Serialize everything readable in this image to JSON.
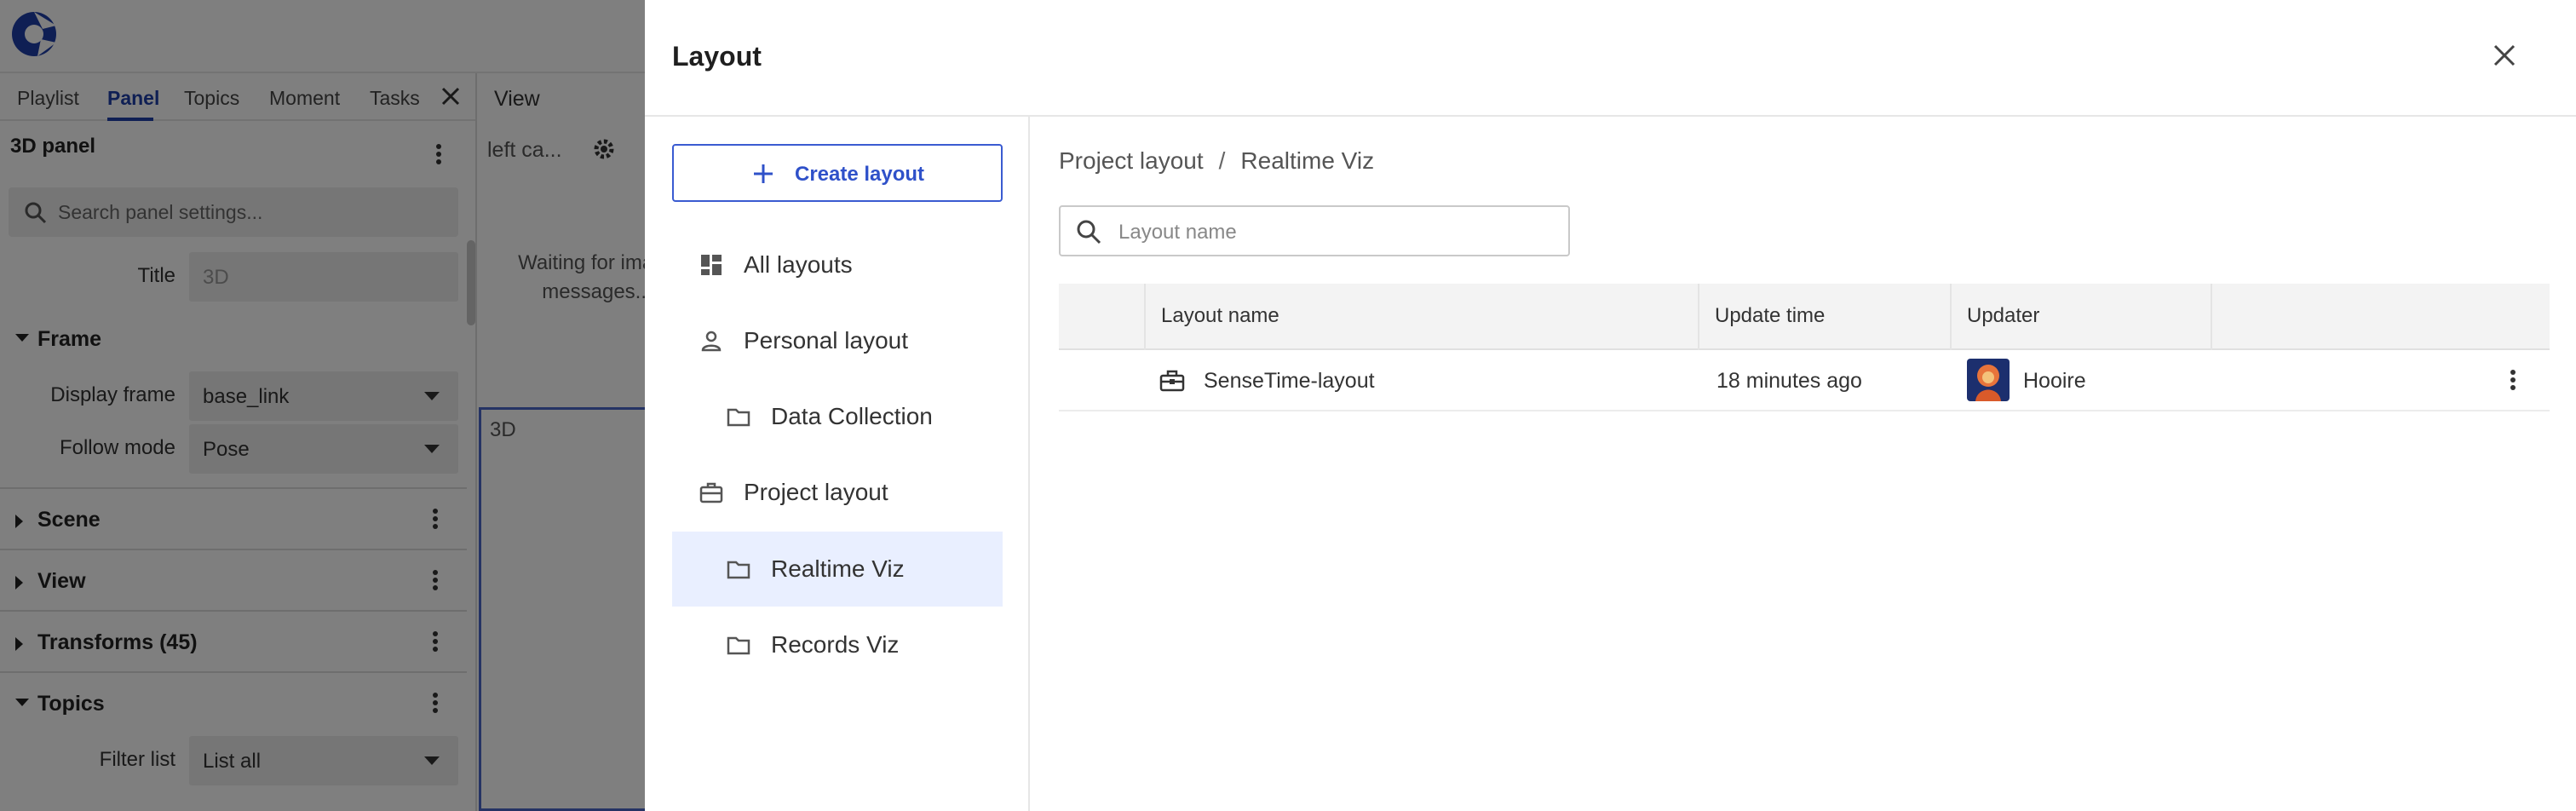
{
  "app": {
    "tabs": [
      "Playlist",
      "Panel",
      "Topics",
      "Moment",
      "Tasks"
    ],
    "panel_title": "3D panel",
    "search_placeholder": "Search panel settings...",
    "title_field": {
      "label": "Title",
      "value": "3D"
    },
    "frame_section": "Frame",
    "display_frame": {
      "label": "Display frame",
      "value": "base_link"
    },
    "follow_mode": {
      "label": "Follow mode",
      "value": "Pose"
    },
    "sections": [
      "Scene",
      "View",
      "Transforms (45)",
      "Topics"
    ],
    "filter_list": {
      "label": "Filter list",
      "value": "List all"
    },
    "view_title": "View",
    "view_sub": "left ca...",
    "waiting": "Waiting for image messages...",
    "pane_3d": "3D"
  },
  "dialog": {
    "title": "Layout",
    "create_label": "Create layout",
    "nav": [
      {
        "label": "All layouts",
        "icon": "dashboard-icon"
      },
      {
        "label": "Personal layout",
        "icon": "person-icon"
      },
      {
        "label": "Data Collection",
        "icon": "folder-icon"
      },
      {
        "label": "Project layout",
        "icon": "briefcase-icon"
      },
      {
        "label": "Realtime Viz",
        "icon": "folder-icon"
      },
      {
        "label": "Records Viz",
        "icon": "folder-icon"
      }
    ],
    "breadcrumb": [
      "Project layout",
      "Realtime Viz"
    ],
    "breadcrumb_sep": "/",
    "search_placeholder": "Layout name",
    "columns": [
      "Layout name",
      "Update time",
      "Updater"
    ],
    "rows": [
      {
        "name": "SenseTime-layout",
        "update_time": "18 minutes ago",
        "updater": "Hooire"
      }
    ]
  },
  "colors": {
    "accent": "#2f51c9",
    "selected_bg": "#e9efff",
    "overlay": "rgba(0,0,0,0.5)"
  }
}
